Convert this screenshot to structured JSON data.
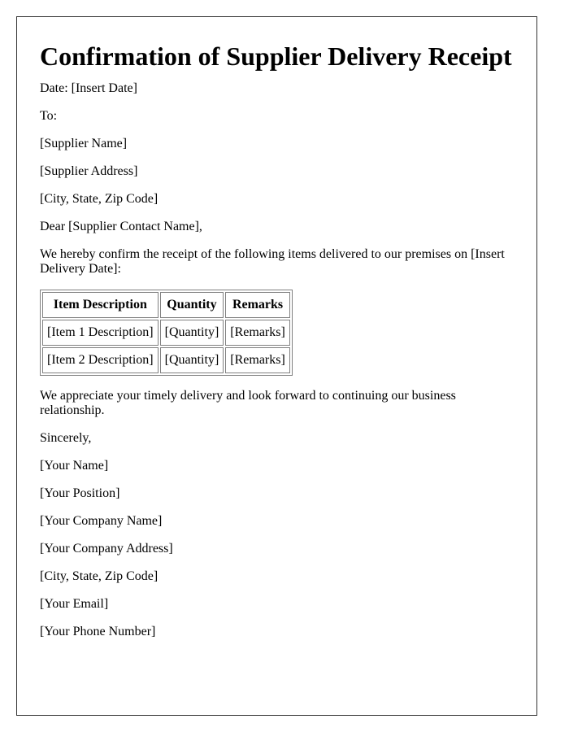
{
  "title": "Confirmation of Supplier Delivery Receipt",
  "date_line": "Date: [Insert Date]",
  "to_label": "To:",
  "recipient": {
    "name": "[Supplier Name]",
    "address": "[Supplier Address]",
    "city_state_zip": "[City, State, Zip Code]"
  },
  "salutation": "Dear [Supplier Contact Name],",
  "intro": "We hereby confirm the receipt of the following items delivered to our premises on [Insert Delivery Date]:",
  "table": {
    "headers": [
      "Item Description",
      "Quantity",
      "Remarks"
    ],
    "rows": [
      [
        "[Item 1 Description]",
        "[Quantity]",
        "[Remarks]"
      ],
      [
        "[Item 2 Description]",
        "[Quantity]",
        "[Remarks]"
      ]
    ]
  },
  "closing_paragraph": "We appreciate your timely delivery and look forward to continuing our business relationship.",
  "sign_off": "Sincerely,",
  "sender": {
    "name": "[Your Name]",
    "position": "[Your Position]",
    "company": "[Your Company Name]",
    "company_address": "[Your Company Address]",
    "city_state_zip": "[City, State, Zip Code]",
    "email": "[Your Email]",
    "phone": "[Your Phone Number]"
  }
}
